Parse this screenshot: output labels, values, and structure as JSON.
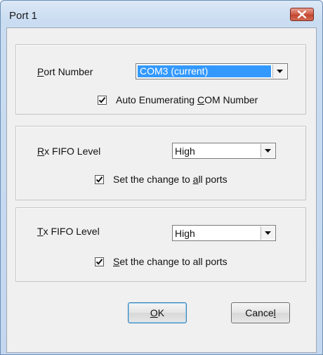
{
  "window": {
    "title": "Port 1"
  },
  "port_group": {
    "port_number_label_key": "P",
    "port_number_label_rest": "ort Number",
    "port_number_value": "COM3 (current)",
    "auto_enum_checked": true,
    "auto_enum_label_pre": "Auto Enumerating ",
    "auto_enum_label_key": "C",
    "auto_enum_label_post": "OM Number"
  },
  "rx_group": {
    "label_key": "R",
    "label_rest": "x FIFO Level",
    "value": "High",
    "apply_all_checked": true,
    "apply_all_pre": "Set the change to ",
    "apply_all_key": "a",
    "apply_all_post": "ll ports"
  },
  "tx_group": {
    "label_key": "T",
    "label_rest": "x FIFO Level",
    "value": "High",
    "apply_all_checked": true,
    "apply_all_key": "S",
    "apply_all_post": "et the change to all ports"
  },
  "buttons": {
    "ok_key": "O",
    "ok_rest": "K",
    "cancel_pre": "Cance",
    "cancel_key": "l"
  },
  "icons": {
    "close": "close-icon",
    "dropdown": "chevron-down-icon",
    "check": "checkmark-icon"
  }
}
